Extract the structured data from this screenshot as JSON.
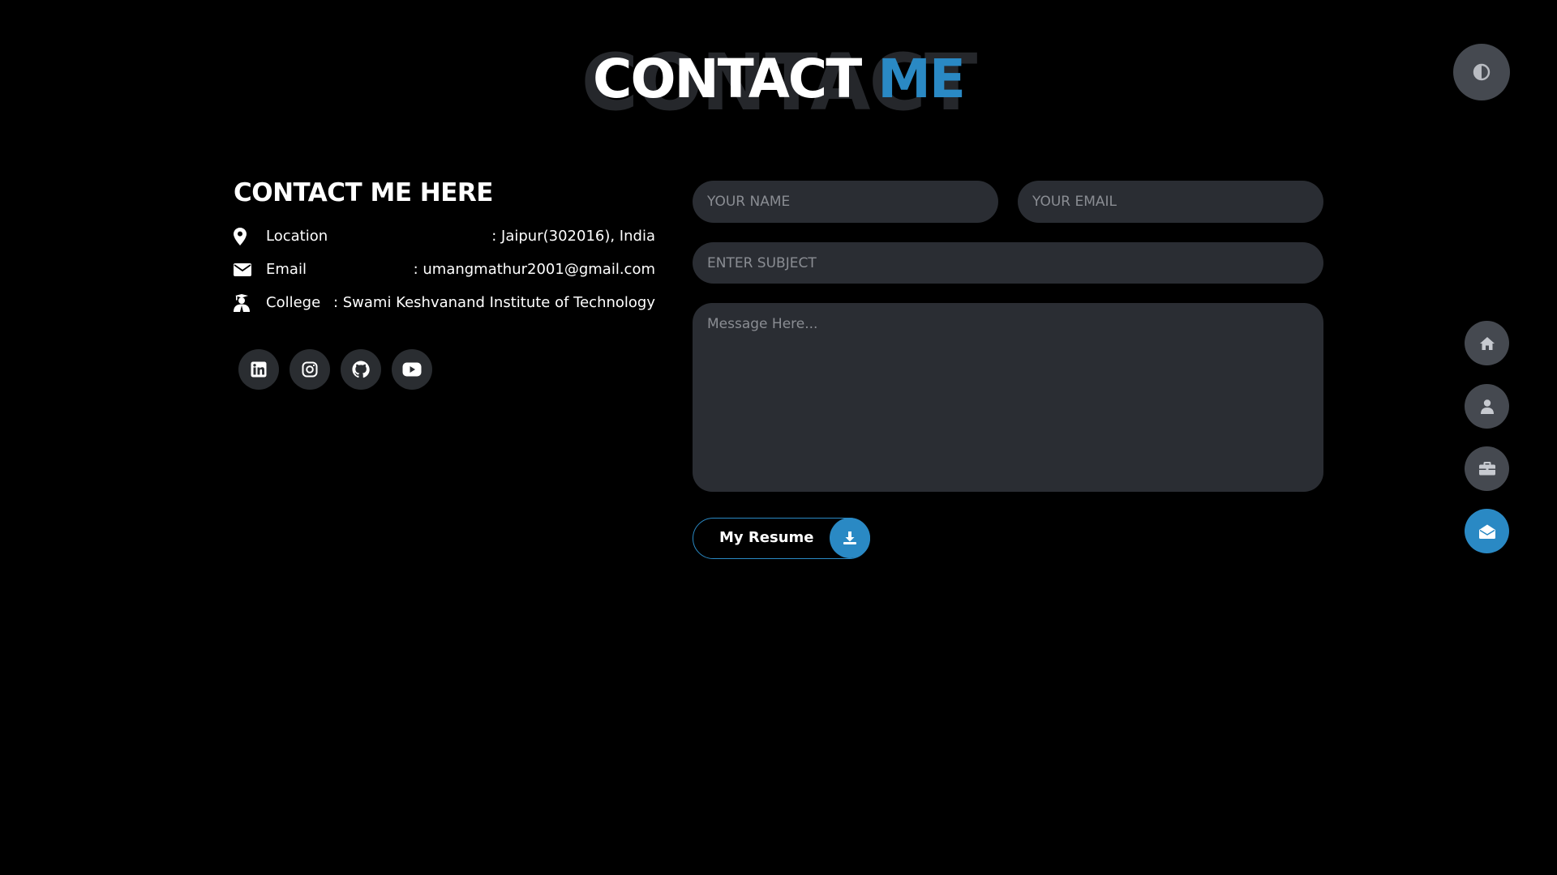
{
  "header": {
    "background_word": "CONTACT",
    "title_word1": "CONTACT",
    "title_word2": "ME",
    "theme_toggle_icon": "half-circle-contrast-icon"
  },
  "contact_info": {
    "heading": "CONTACT ME HERE",
    "rows": [
      {
        "icon": "map-pin-icon",
        "label": "Location",
        "value": ": Jaipur(302016), India"
      },
      {
        "icon": "envelope-icon",
        "label": "Email",
        "value": ": umangmathur2001@gmail.com"
      },
      {
        "icon": "graduate-icon",
        "label": "College",
        "value": ": Swami Keshvanand Institute of Technology"
      }
    ],
    "socials": [
      "linkedin-icon",
      "instagram-icon",
      "github-icon",
      "youtube-icon"
    ]
  },
  "form": {
    "name_placeholder": "YOUR NAME",
    "email_placeholder": "YOUR EMAIL",
    "subject_placeholder": "ENTER SUBJECT",
    "message_placeholder": "Message Here...",
    "resume_label": "My Resume",
    "resume_icon": "download-icon"
  },
  "nav": {
    "items": [
      {
        "name": "home",
        "icon": "home-icon",
        "active": false
      },
      {
        "name": "about",
        "icon": "user-icon",
        "active": false
      },
      {
        "name": "portfolio",
        "icon": "briefcase-icon",
        "active": false
      },
      {
        "name": "contact",
        "icon": "envelope-open-icon",
        "active": true
      }
    ]
  },
  "colors": {
    "accent": "#2a89c4",
    "background": "#000000",
    "input_bg": "#2a2d33",
    "nav_bg": "#454950",
    "title_ghost": "#25272b"
  }
}
